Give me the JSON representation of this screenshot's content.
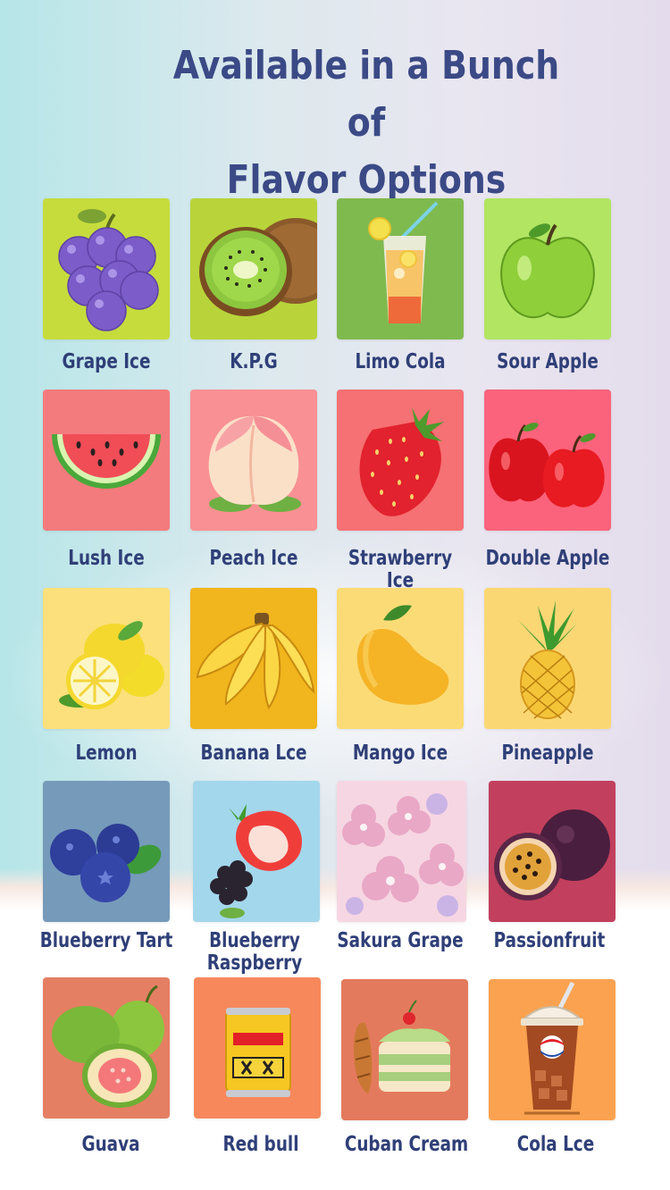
{
  "title_line1": "Available in a Bunch of",
  "title_line2": "Flavor Options",
  "flavors": [
    {
      "name": "Grape Ice",
      "icon": "grape-icon",
      "bg": "#c6dc3c"
    },
    {
      "name": "K.P.G",
      "icon": "kiwi-icon",
      "bg": "#b8d43a"
    },
    {
      "name": "Limo Cola",
      "icon": "lemonade-glass-icon",
      "bg": "#7fba4f"
    },
    {
      "name": "Sour Apple",
      "icon": "green-apple-icon",
      "bg": "#b1e562"
    },
    {
      "name": "Lush Ice",
      "icon": "watermelon-icon",
      "bg": "#f47b7d"
    },
    {
      "name": "Peach Ice",
      "icon": "peach-icon",
      "bg": "#f99093"
    },
    {
      "name": "Strawberry Ice",
      "icon": "strawberry-icon",
      "bg": "#f57173"
    },
    {
      "name": "Double Apple",
      "icon": "red-apples-icon",
      "bg": "#fb637c"
    },
    {
      "name": "Lemon",
      "icon": "lemon-icon",
      "bg": "#fbe07c"
    },
    {
      "name": "Banana Lce",
      "icon": "banana-icon",
      "bg": "#f1b51d"
    },
    {
      "name": "Mango Ice",
      "icon": "mango-icon",
      "bg": "#fbdb76"
    },
    {
      "name": "Pineapple",
      "icon": "pineapple-icon",
      "bg": "#fbd774"
    },
    {
      "name": "Blueberry Tart",
      "icon": "blueberry-icon",
      "bg": "#769aba"
    },
    {
      "name": "Blueberry\nRaspberry",
      "icon": "berry-mix-icon",
      "bg": "#a3d7ec"
    },
    {
      "name": "Sakura Grape",
      "icon": "sakura-icon",
      "bg": "#f6d6e2"
    },
    {
      "name": "Passionfruit",
      "icon": "passionfruit-icon",
      "bg": "#c2405d"
    },
    {
      "name": "Guava",
      "icon": "guava-icon",
      "bg": "#e57f63"
    },
    {
      "name": "Red bull",
      "icon": "energy-can-icon",
      "bg": "#f7885b"
    },
    {
      "name": "Cuban Cream",
      "icon": "cake-icon",
      "bg": "#e47a5d"
    },
    {
      "name": "Cola Lce",
      "icon": "cola-cup-icon",
      "bg": "#faa250"
    }
  ]
}
